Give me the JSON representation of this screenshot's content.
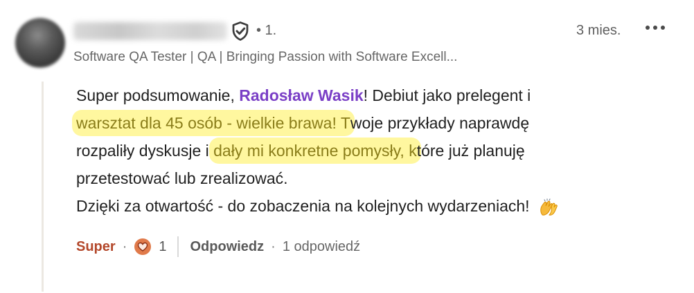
{
  "author": {
    "name_blurred": "",
    "verified_icon": "shield-check-icon",
    "connection_degree": "• 1.",
    "headline": "Software QA Tester | QA | Bringing Passion with Software Excell...",
    "timestamp": "3 mies.",
    "more_icon": "more-horizontal-icon"
  },
  "comment": {
    "part1": "Super podsumowanie, ",
    "mention": "Radosław Wasik",
    "part2": "! Debiut jako prelegent i",
    "highlight1": "warsztat dla 45 osób - wielkie brawa! T",
    "part3": "woje przykłady naprawdę",
    "part4": "rozpaliły dyskusje i ",
    "highlight2": "dały mi konkretne pomysły, k",
    "part5": "tóre już planuję",
    "part6": "przetestować lub zrealizować.",
    "part7": "Dzięki za otwartość - do zobaczenia na kolejnych wydarzeniach!",
    "emoji_icon": "clapping-hands-icon"
  },
  "actions": {
    "react_label": "Super",
    "dot": "·",
    "reaction_icon": "heart-icon",
    "reaction_count": "1",
    "reply_label": "Odpowiedz",
    "replies_label": "1 odpowiedź"
  },
  "colors": {
    "mention": "#7a3fc6",
    "react": "#b3472a",
    "highlight": "#fff050"
  }
}
